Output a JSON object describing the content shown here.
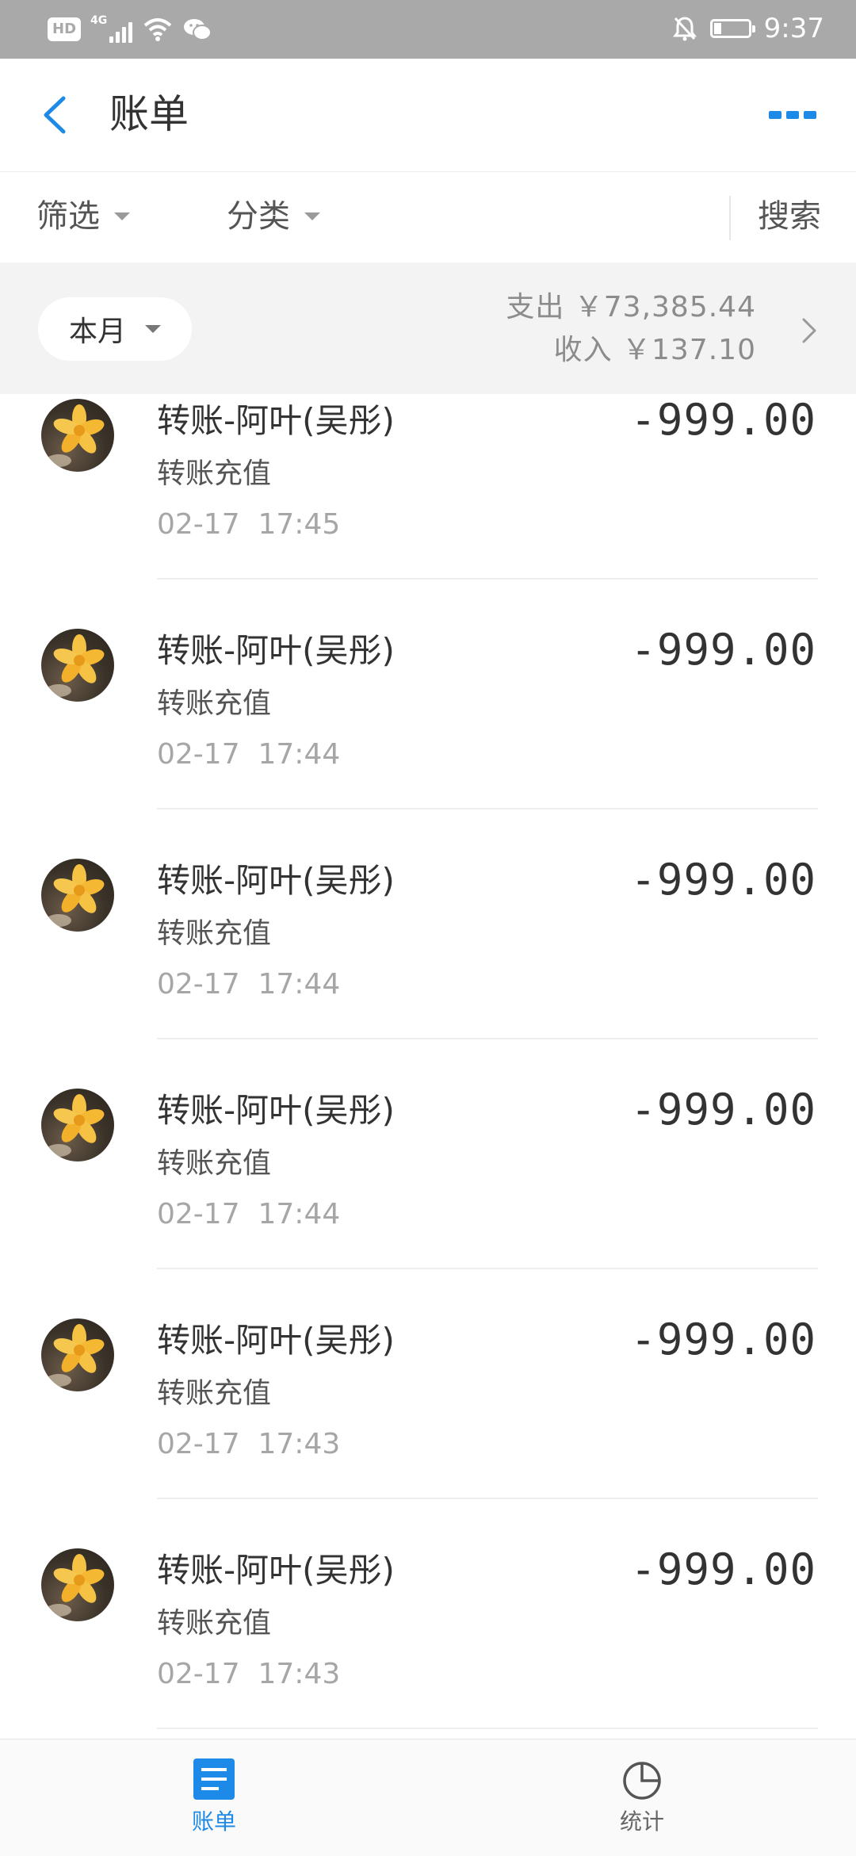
{
  "status_bar": {
    "hd": "HD",
    "network": "4G",
    "time": "9:37",
    "battery_level": 0.2
  },
  "header": {
    "title": "账单"
  },
  "filters": {
    "filter_label": "筛选",
    "category_label": "分类",
    "search_label": "搜索"
  },
  "summary": {
    "month_label": "本月",
    "expense_text": "支出 ￥73,385.44",
    "income_text": "收入 ￥137.10"
  },
  "transactions": [
    {
      "title": "转账-阿叶(吴彤)",
      "subtitle": "转账充值",
      "date": "02-17",
      "time": "17:45",
      "amount": "-999.00"
    },
    {
      "title": "转账-阿叶(吴彤)",
      "subtitle": "转账充值",
      "date": "02-17",
      "time": "17:44",
      "amount": "-999.00"
    },
    {
      "title": "转账-阿叶(吴彤)",
      "subtitle": "转账充值",
      "date": "02-17",
      "time": "17:44",
      "amount": "-999.00"
    },
    {
      "title": "转账-阿叶(吴彤)",
      "subtitle": "转账充值",
      "date": "02-17",
      "time": "17:44",
      "amount": "-999.00"
    },
    {
      "title": "转账-阿叶(吴彤)",
      "subtitle": "转账充值",
      "date": "02-17",
      "time": "17:43",
      "amount": "-999.00"
    },
    {
      "title": "转账-阿叶(吴彤)",
      "subtitle": "转账充值",
      "date": "02-17",
      "time": "17:43",
      "amount": "-999.00"
    }
  ],
  "bottom_nav": {
    "bill_label": "账单",
    "stats_label": "统计"
  },
  "colors": {
    "accent": "#1e8ae8",
    "status_bar": "#a9a9a9",
    "summary_bg": "#f3f3f3"
  }
}
